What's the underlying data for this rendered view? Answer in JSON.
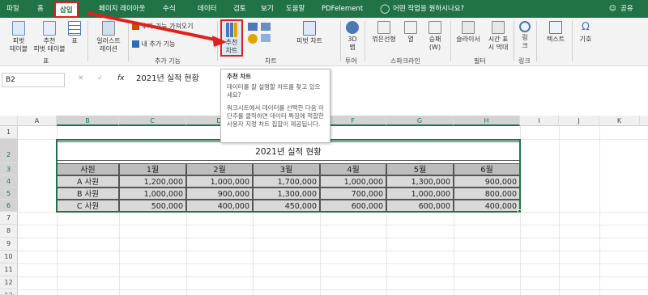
{
  "tabs": {
    "file": "파일",
    "home": "홈",
    "insert": "삽입",
    "page_layout": "페이지 레이아웃",
    "formulas": "수식",
    "data": "데이터",
    "review": "검토",
    "view": "보기",
    "help": "도움말",
    "pdfelement": "PDFelement",
    "tell_me": "어떤 작업을 원하시나요?",
    "share": "공유"
  },
  "ribbon": {
    "pivot": "피벗\n테이블",
    "rec_pivot": "추천\n피벗 테이블",
    "table": "표",
    "group_table": "표",
    "illustrations": "일러스트\n레이션",
    "get_addins": "추가 기능 가져오기",
    "my_addins": "내 추가 기능",
    "group_addins": "추가 기능",
    "rec_chart": "추천\n차트",
    "pivot_chart": "피벗 차트",
    "group_chart": "차트",
    "map3d": "3D\n맵",
    "group_tour": "투어",
    "line": "꺾은선형",
    "column": "열",
    "winloss": "승패\n(W)",
    "group_sparkline": "스파크라인",
    "slicer": "슬라이서",
    "timeline": "시간 표\n시 막대",
    "group_filter": "필터",
    "link": "링\n크",
    "group_link": "링크",
    "text": "텍스트",
    "symbol": "기호"
  },
  "tooltip": {
    "title": "추천 차트",
    "line1": "데이터를 잘 설명할 차트를 찾고 있으세요?",
    "line2": "워크시트에서 데이터를 선택한 다음 이 단추를 클릭하면 데이터 특징에 적합한 사용자 지정 차트 집합이 제공됩니다."
  },
  "formula_bar": {
    "name_box": "B2",
    "fx": "fx",
    "content": "2021년 실적 현황"
  },
  "columns": [
    "A",
    "B",
    "C",
    "D",
    "E",
    "F",
    "G",
    "H",
    "I",
    "J",
    "K"
  ],
  "rows": [
    "1",
    "2",
    "3",
    "4",
    "5",
    "6",
    "7",
    "8",
    "9",
    "10",
    "11",
    "12",
    "13"
  ],
  "sheet": {
    "title": "2021년 실적 현황",
    "headers": [
      "사원",
      "1월",
      "2월",
      "3월",
      "4월",
      "5월",
      "6월"
    ],
    "data": [
      [
        "A 사원",
        "1,200,000",
        "1,000,000",
        "1,700,000",
        "1,000,000",
        "1,300,000",
        "900,000"
      ],
      [
        "B 사원",
        "1,000,000",
        "900,000",
        "1,300,000",
        "700,000",
        "1,000,000",
        "800,000"
      ],
      [
        "C 사원",
        "500,000",
        "400,000",
        "450,000",
        "600,000",
        "600,000",
        "400,000"
      ]
    ]
  },
  "colors": {
    "brand": "#217346",
    "highlight": "#e0201c"
  }
}
